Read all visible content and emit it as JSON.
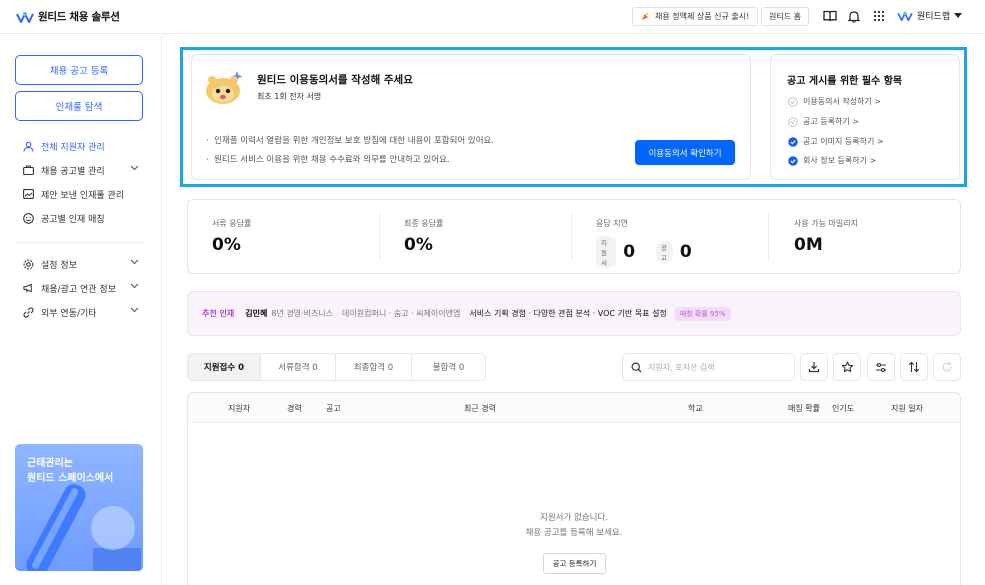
{
  "app": {
    "logo_text": "원티드 채용 솔루션",
    "brand_color": "#3366ff"
  },
  "header": {
    "promo_text": "채용 정액제 상품 신규 출시!",
    "home_label": "원티드 홈",
    "user_name": "원티드랩",
    "icons": [
      "book-icon",
      "bell-icon",
      "apps-grid-icon",
      "company-logo-icon",
      "caret-down-icon"
    ]
  },
  "sidebar": {
    "post_job_label": "채용 공고 등록",
    "talent_search_label": "인재풀 탐색",
    "items": [
      {
        "label": "전체 지원자 관리",
        "icon": "person-icon",
        "active": true
      },
      {
        "label": "채용 공고별 관리",
        "icon": "briefcase-icon",
        "expandable": true
      },
      {
        "label": "제안 보낸 인재풀 관리",
        "icon": "image-icon"
      },
      {
        "label": "공고별 인재 매칭",
        "icon": "smile-icon"
      },
      {
        "label": "설정 정보",
        "icon": "gear-icon",
        "expandable": true
      },
      {
        "label": "채용/광고 연관 정보",
        "icon": "megaphone-icon",
        "expandable": true
      },
      {
        "label": "외부 연동/기타",
        "icon": "link-icon",
        "expandable": true
      }
    ],
    "promo_line1": "근태관리는",
    "promo_line2": "원티드 스페이스에서"
  },
  "consent": {
    "title": "원티드 이용동의서를 작성해 주세요",
    "subtitle": "최초 1회 전자 서명",
    "bullets": [
      "인재풀 이력서 열람을 위한 개인정보 보호 방침에 대한 내용이 포함되어 있어요.",
      "원티드 서비스 이용을 위한 채용 수수료와 의무를 안내하고 있어요."
    ],
    "button_label": "이용동의서 확인하기"
  },
  "requirements": {
    "title": "공고 게시를 위한 필수 항목",
    "items": [
      {
        "label": "이용동의서 작성하기 >",
        "done": false
      },
      {
        "label": "공고 등록하기 >",
        "done": false
      },
      {
        "label": "공고 이미지 등록하기 >",
        "done": true
      },
      {
        "label": "회사 정보 등록하기 >",
        "done": true
      }
    ]
  },
  "stats": {
    "doc_response_label": "서류 응답률",
    "doc_response_value": "0%",
    "final_response_label": "최종 응답률",
    "final_response_value": "0%",
    "delay_label": "응답 지연",
    "delay_applicant_badge": "지원서",
    "delay_applicant_value": "0",
    "delay_post_badge": "공고",
    "delay_post_value": "0",
    "mileage_label": "사용 가능 마일리지",
    "mileage_value": "0M"
  },
  "recommend": {
    "label": "추천 인재",
    "name": "김민혜",
    "meta": "8년 경영·비즈니스",
    "companies": "데이원컴퍼니 · 숨고 · 씨제이이앤엠",
    "skills": "서비스 기획 경험 · 다양한 관점 분석 · VOC 기반 목표 설정",
    "match": "매칭 확률 95%"
  },
  "tabs": [
    {
      "label": "지원접수 0"
    },
    {
      "label": "서류합격 0"
    },
    {
      "label": "최종합격 0"
    },
    {
      "label": "불합격 0"
    }
  ],
  "search": {
    "placeholder": "지원자, 포지션 검색"
  },
  "toolbar_icons": [
    "download-icon",
    "star-icon",
    "filter-sliders-icon",
    "sort-icon",
    "refresh-icon"
  ],
  "table": {
    "columns": [
      "지원자",
      "경력",
      "공고",
      "최근 경력",
      "학교",
      "매칭 확률",
      "인기도",
      "지원 일자"
    ],
    "empty_line1": "지원서가 없습니다.",
    "empty_line2": "채용 공고를 등록해 보세요.",
    "empty_button": "공고 등록하기"
  }
}
